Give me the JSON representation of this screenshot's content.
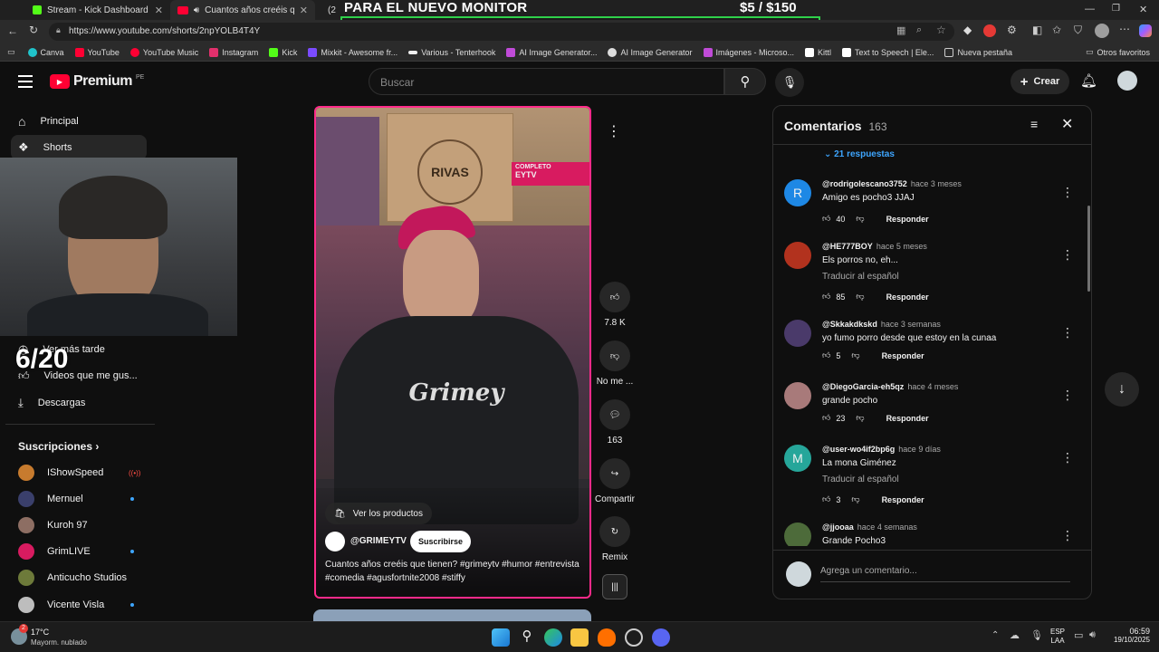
{
  "browser": {
    "tabs": [
      {
        "title": "Stream - Kick Dashboard",
        "icon": "kick-icon"
      },
      {
        "title": "Cuantos años creéis que tien",
        "icon": "youtube-icon"
      },
      {
        "title": "(2",
        "icon": "whatsapp-icon"
      }
    ],
    "url": "https://www.youtube.com/shorts/2npYOLB4T4Y",
    "bookmarks": [
      "Canva",
      "YouTube",
      "YouTube Music",
      "Instagram",
      "Kick",
      "Mixkit - Awesome fr...",
      "Various - Tenterhook",
      "AI Image Generator...",
      "AI Image Generator",
      "Imágenes - Microso...",
      "Kittl",
      "Text to Speech | Ele...",
      "Nueva pestaña"
    ],
    "other_favorites": "Otros favoritos"
  },
  "overlay": {
    "title": "PARA EL NUEVO MONITOR",
    "price": "$5  / $150",
    "progress": 0.03,
    "count": "6/20"
  },
  "yt": {
    "logo": "Premium",
    "region": "PE",
    "search_placeholder": "Buscar",
    "create_label": "Crear",
    "nav": {
      "principal": "Principal",
      "shorts": "Shorts",
      "ver_mas_tarde": "Ver más tarde",
      "videos_gusta": "Videos que me gus...",
      "descargas": "Descargas"
    },
    "subs_title": "Suscripciones",
    "subs": [
      "IShowSpeed",
      "Mernuel",
      "Kuroh 97",
      "GrimLIVE",
      "Anticucho Studios",
      "Vicente Visla"
    ]
  },
  "video": {
    "banner_small": "COMPLETO",
    "banner_big": "EYTV",
    "box_label": "RIVAS",
    "shirt_text": "Grimey",
    "products_label": "Ver los productos",
    "channel": "@GRIMEYTV",
    "subscribe_label": "Suscribirse",
    "caption": "Cuantos años creéis que tienen? #grimeytv #humor #entrevista #comedia #agusfortnite2008 #stiffy",
    "likes": "7.8 K",
    "dislike_label": "No me ...",
    "comments_count": "163",
    "share_label": "Compartir",
    "remix_label": "Remix"
  },
  "comments": {
    "title": "Comentarios",
    "count": "163",
    "replies_label": "21 respuestas",
    "add_placeholder": "Agrega un comentario...",
    "reply_label": "Responder",
    "translate_label": "Traducir al español",
    "items": [
      {
        "user": "@rodrigolescano3752",
        "time": "hace 3 meses",
        "text": "Amigo es pocho3 JJAJ",
        "likes": "40",
        "initial": "R",
        "color": "#1e88e5"
      },
      {
        "user": "@HE777BOY",
        "time": "hace 5 meses",
        "text": "Els porros no, eh...",
        "likes": "85",
        "initial": "",
        "color": "#b2321e"
      },
      {
        "user": "@Skkakdkskd",
        "time": "hace 3 semanas",
        "text": "yo fumo porro desde que estoy en la cunaa",
        "likes": "5",
        "initial": "",
        "color": "#4a3a6a"
      },
      {
        "user": "@DiegoGarcia-eh5qz",
        "time": "hace 4 meses",
        "text": "grande pocho",
        "likes": "23",
        "initial": "",
        "color": "#a87a7a"
      },
      {
        "user": "@user-wo4if2bp6g",
        "time": "hace 9 días",
        "text": "La mona Giménez",
        "likes": "3",
        "initial": "M",
        "color": "#26a69a"
      },
      {
        "user": "@jjooaa",
        "time": "hace 4 semanas",
        "text": "Grande Pocho3",
        "likes": "",
        "initial": "",
        "color": "#4d6b3a"
      }
    ]
  },
  "taskbar": {
    "temp": "17°C",
    "weather": "Mayorm. nublado",
    "weather_badge": "2",
    "lang": "ESP",
    "lang2": "LAA",
    "time": "06:59",
    "date": "19/10/2025"
  }
}
